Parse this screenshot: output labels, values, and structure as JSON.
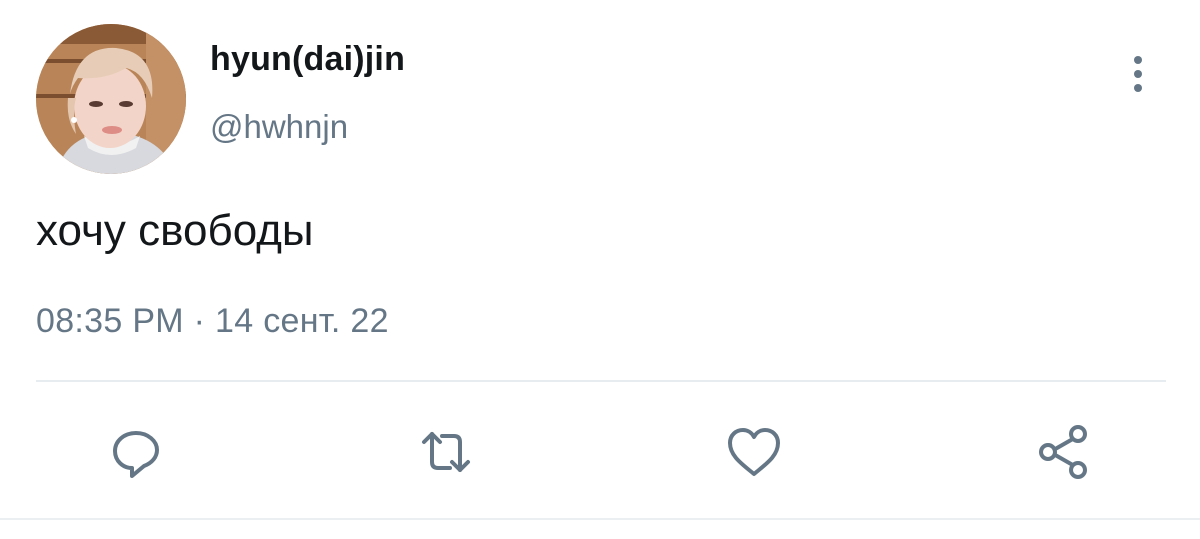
{
  "user": {
    "display_name": "hyun(dai)jin",
    "handle": "@hwhnjn"
  },
  "tweet": {
    "text": "хочу свободы",
    "timestamp": "08:35 PM · 14 сент. 22"
  },
  "actions": [
    {
      "icon": "reply-icon"
    },
    {
      "icon": "retweet-icon"
    },
    {
      "icon": "like-icon"
    },
    {
      "icon": "share-icon"
    }
  ],
  "colors": {
    "text_primary": "#14171a",
    "text_secondary": "#657786",
    "icon": "#657786",
    "divider": "#e6ecf0"
  }
}
